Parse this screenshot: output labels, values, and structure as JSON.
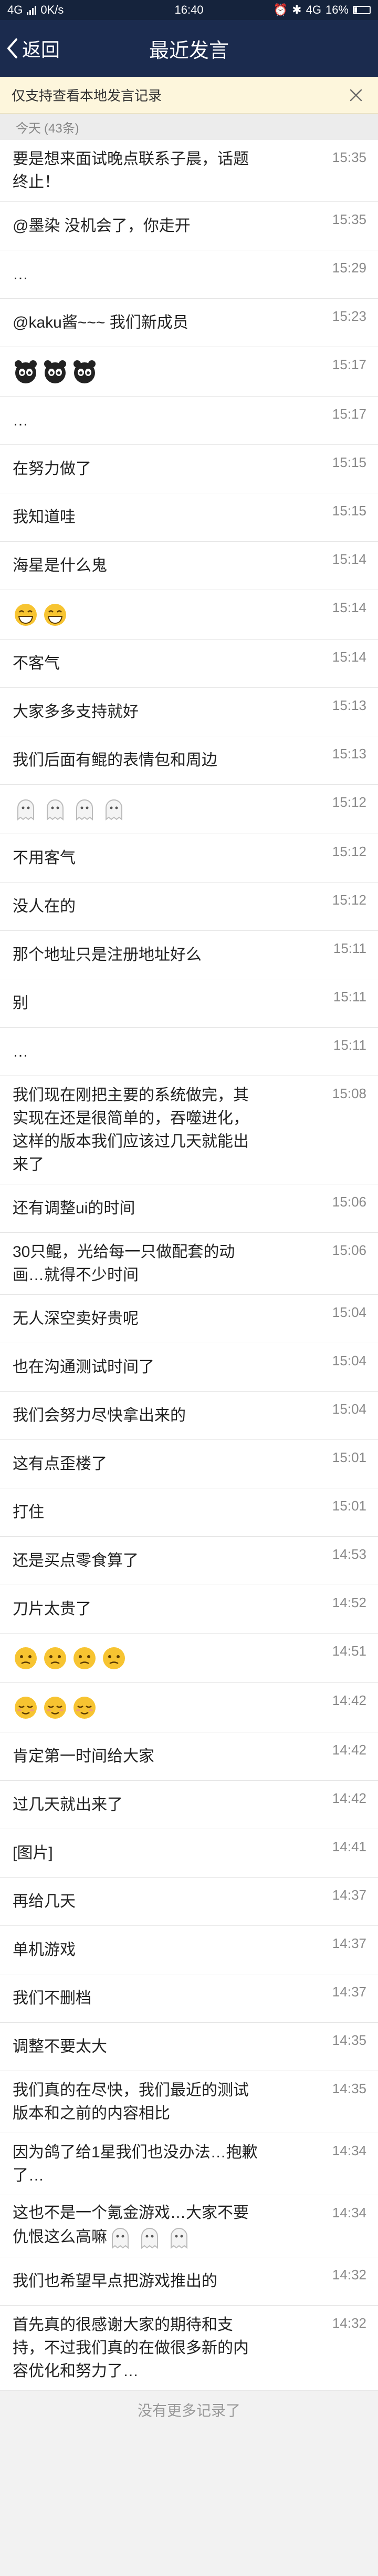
{
  "status_bar": {
    "network": "4G",
    "speed": "0K/s",
    "time": "16:40",
    "battery": "16%",
    "battery_level": 0.16
  },
  "nav": {
    "back_label": "返回",
    "title": "最近发言"
  },
  "notice": {
    "text": "仅支持查看本地发言记录"
  },
  "day_header": {
    "label": "今天",
    "count": "(43条)"
  },
  "messages": [
    {
      "text": "要是想来面试晚点联系子晨，话题\n终止！",
      "time": "15:35"
    },
    {
      "text": "@墨染 没机会了，你走开",
      "time": "15:35"
    },
    {
      "text": "…",
      "time": "15:29"
    },
    {
      "text": "@kaku酱~~~ 我们新成员",
      "time": "15:23"
    },
    {
      "text": "",
      "time": "15:17",
      "emoji": "panda",
      "emoji_count": 3
    },
    {
      "text": "…",
      "time": "15:17"
    },
    {
      "text": "在努力做了",
      "time": "15:15"
    },
    {
      "text": "我知道哇",
      "time": "15:15"
    },
    {
      "text": "海星是什么鬼",
      "time": "15:14"
    },
    {
      "text": "",
      "time": "15:14",
      "emoji": "grin",
      "emoji_count": 2
    },
    {
      "text": "不客气",
      "time": "15:14"
    },
    {
      "text": "大家多多支持就好",
      "time": "15:13"
    },
    {
      "text": "我们后面有鲲的表情包和周边",
      "time": "15:13"
    },
    {
      "text": "",
      "time": "15:12",
      "emoji": "ghost",
      "emoji_count": 4
    },
    {
      "text": "不用客气",
      "time": "15:12"
    },
    {
      "text": "没人在的",
      "time": "15:12"
    },
    {
      "text": "那个地址只是注册地址好么",
      "time": "15:11"
    },
    {
      "text": "别",
      "time": "15:11"
    },
    {
      "text": "…",
      "time": "15:11"
    },
    {
      "text": "我们现在刚把主要的系统做完，其\n实现在还是很简单的，吞噬进化，\n这样的版本我们应该过几天就能出\n来了",
      "time": "15:08"
    },
    {
      "text": "还有调整ui的时间",
      "time": "15:06"
    },
    {
      "text": "30只鲲，光给每一只做配套的动\n画…就得不少时间",
      "time": "15:06"
    },
    {
      "text": "无人深空卖好贵呢",
      "time": "15:04"
    },
    {
      "text": "也在沟通测试时间了",
      "time": "15:04"
    },
    {
      "text": "我们会努力尽快拿出来的",
      "time": "15:04"
    },
    {
      "text": "这有点歪楼了",
      "time": "15:01"
    },
    {
      "text": "打住",
      "time": "15:01"
    },
    {
      "text": "还是买点零食算了",
      "time": "14:53"
    },
    {
      "text": "刀片太贵了",
      "time": "14:52"
    },
    {
      "text": "",
      "time": "14:51",
      "emoji": "confused",
      "emoji_count": 4
    },
    {
      "text": "",
      "time": "14:42",
      "emoji": "relieved",
      "emoji_count": 3
    },
    {
      "text": "肯定第一时间给大家",
      "time": "14:42"
    },
    {
      "text": "过几天就出来了",
      "time": "14:42"
    },
    {
      "text": "[图片]",
      "time": "14:41"
    },
    {
      "text": "再给几天",
      "time": "14:37"
    },
    {
      "text": "单机游戏",
      "time": "14:37"
    },
    {
      "text": "我们不删档",
      "time": "14:37"
    },
    {
      "text": "调整不要太大",
      "time": "14:35"
    },
    {
      "text": "我们真的在尽快，我们最近的测试\n版本和之前的内容相比",
      "time": "14:35"
    },
    {
      "text": "因为鸽了给1星我们也没办法…抱歉\n了…",
      "time": "14:34"
    },
    {
      "text": "这也不是一个氪金游戏…大家不要\n仇恨这么高嘛",
      "time": "14:34",
      "emoji": "ghost",
      "emoji_count": 3
    },
    {
      "text": "我们也希望早点把游戏推出的",
      "time": "14:32"
    },
    {
      "text": "首先真的很感谢大家的期待和支\n持，不过我们真的在做很多新的内\n容优化和努力了…",
      "time": "14:32"
    }
  ],
  "footer": {
    "text": "没有更多记录了"
  },
  "colors": {
    "status_bar": "#15233c",
    "nav_bar": "#1b2b4e",
    "notice_bg": "#fdf6dc",
    "page_bg": "#f2f2f2"
  }
}
